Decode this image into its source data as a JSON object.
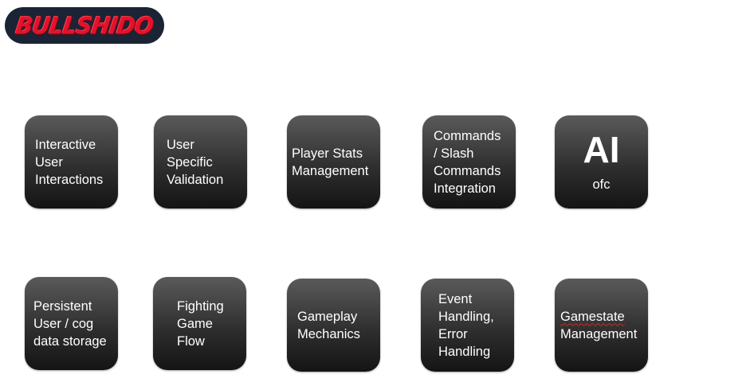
{
  "logo": {
    "text": "BULLSHIDO"
  },
  "tiles": {
    "interactive": "Interactive\nUser\nInteractions",
    "validation": "User\nSpecific\nValidation",
    "player_stats": "Player Stats\nManagement",
    "commands": "Commands\n/ Slash\nCommands\nIntegration",
    "ai_title": "AI",
    "ai_sub": "ofc",
    "persistent": "Persistent\nUser / cog\ndata storage",
    "fighting": "Fighting\nGame\nFlow",
    "gameplay": "Gameplay\nMechanics",
    "event": "Event\nHandling,\nError\nHandling",
    "gamestate_word": "Gamestate",
    "gamestate_rest": "Management"
  }
}
